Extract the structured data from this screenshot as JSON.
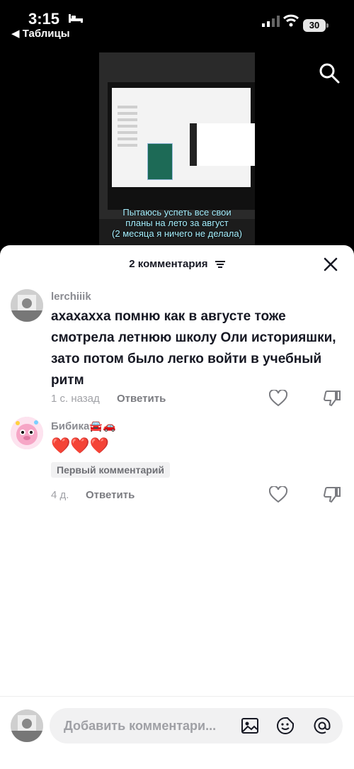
{
  "status": {
    "time": "3:15",
    "battery": "30",
    "back_label": "◀ Таблицы"
  },
  "video": {
    "caption_lines": [
      "Пытаюсь успеть все свои",
      "планы на лето за август",
      "(2 месяца я ничего не делала)"
    ]
  },
  "panel": {
    "title": "2 комментария"
  },
  "comments": [
    {
      "username": "lerchiiik",
      "text": "ахахахха помню как в августе тоже смотрела летнюю школу Оли историяшки, зато потом было легко войти в учебный ритм",
      "time": "1 с. назад",
      "reply": "Ответить"
    },
    {
      "username": "Бибика🚘🚗",
      "text": "❤️❤️❤️",
      "badge": "Первый комментарий",
      "time": "4 д.",
      "reply": "Ответить"
    }
  ],
  "composer": {
    "placeholder": "Добавить комментари..."
  },
  "icons": [
    "search-icon",
    "close-icon",
    "heart-icon",
    "dislike-icon",
    "image-icon",
    "emoji-icon",
    "mention-icon",
    "sort-icon"
  ]
}
